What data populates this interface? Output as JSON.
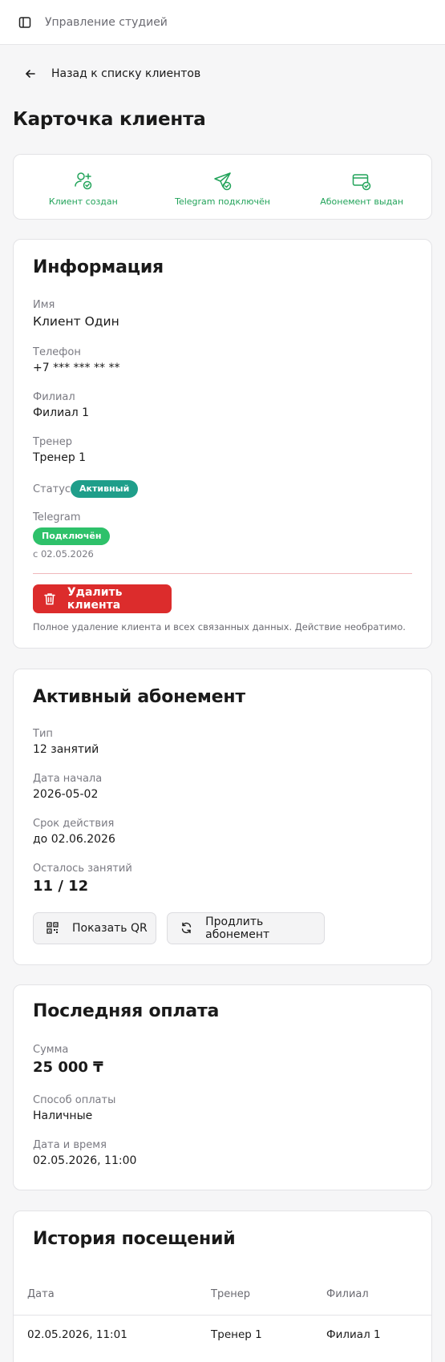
{
  "topbar": {
    "title": "Управление студией",
    "toggle_icon": "sidebar-toggle-icon"
  },
  "back": {
    "label": "Назад к списку клиентов"
  },
  "page_title": "Карточка клиента",
  "colors": {
    "accent_green": "#22a35a",
    "danger": "#dc2c2c",
    "status_teal": "#1f9e8a",
    "telegram_green": "#2ec16a"
  },
  "steps": [
    {
      "label": "Клиент создан",
      "icon": "user-plus-check-icon"
    },
    {
      "label": "Telegram подключён",
      "icon": "send-check-icon"
    },
    {
      "label": "Абонемент выдан",
      "icon": "card-check-icon"
    }
  ],
  "info": {
    "title": "Информация",
    "name_label": "Имя",
    "name_value": "Клиент Один",
    "phone_label": "Телефон",
    "phone_value": "+7 *** *** ** **",
    "branch_label": "Филиал",
    "branch_value": "Филиал 1",
    "trainer_label": "Тренер",
    "trainer_value": "Тренер 1",
    "status_label": "Статус",
    "status_badge": "Активный",
    "telegram_label": "Telegram",
    "telegram_badge": "Подключён",
    "telegram_since": "с 02.05.2026",
    "delete_label": "Удалить клиента",
    "delete_note": "Полное удаление клиента и всех связанных данных. Действие необратимо."
  },
  "subscription": {
    "title": "Активный абонемент",
    "type_label": "Тип",
    "type_value": "12 занятий",
    "start_label": "Дата начала",
    "start_value": "2026-05-02",
    "valid_label": "Срок действия",
    "valid_value": "до 02.06.2026",
    "left_label": "Осталось занятий",
    "left_value": "11 / 12",
    "qr_button": "Показать QR",
    "renew_button": "Продлить абонемент"
  },
  "payment": {
    "title": "Последняя оплата",
    "amount_label": "Сумма",
    "amount_value": "25 000 ₸",
    "method_label": "Способ оплаты",
    "method_value": "Наличные",
    "datetime_label": "Дата и время",
    "datetime_value": "02.05.2026, 11:00"
  },
  "visits": {
    "title": "История посещений",
    "columns": [
      "Дата",
      "Тренер",
      "Филиал"
    ],
    "rows": [
      [
        "02.05.2026, 11:01",
        "Тренер 1",
        "Филиал 1"
      ]
    ]
  }
}
